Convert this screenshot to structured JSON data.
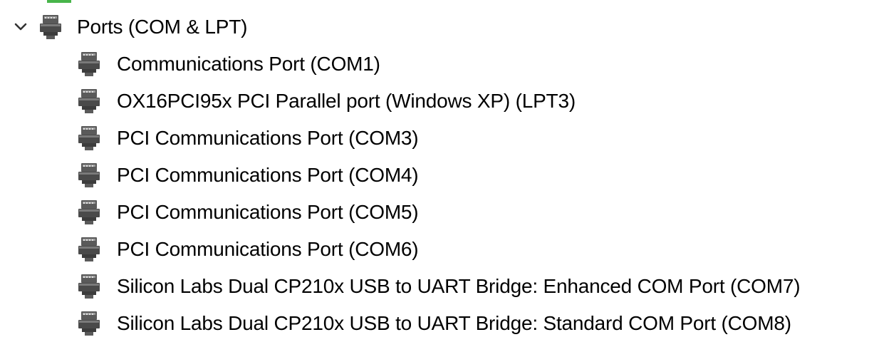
{
  "tree": {
    "category": {
      "label": "Ports (COM & LPT)",
      "expanded": true,
      "expander_icon": "chevron-down-icon",
      "icon": "port-icon"
    },
    "devices": [
      {
        "label": "Communications Port (COM1)"
      },
      {
        "label": "OX16PCI95x PCI Parallel port (Windows XP) (LPT3)"
      },
      {
        "label": "PCI Communications Port (COM3)"
      },
      {
        "label": "PCI Communications Port (COM4)"
      },
      {
        "label": "PCI Communications Port (COM5)"
      },
      {
        "label": "PCI Communications Port (COM6)"
      },
      {
        "label": "Silicon Labs Dual CP210x USB to UART Bridge: Enhanced COM Port (COM7)"
      },
      {
        "label": "Silicon Labs Dual CP210x USB to UART Bridge: Standard COM Port (COM8)"
      }
    ]
  },
  "colors": {
    "background": "#ffffff",
    "text": "#000000",
    "icon_dark": "#4a4a4a",
    "icon_light": "#8a8a8a",
    "accent_green": "#48b54a"
  }
}
